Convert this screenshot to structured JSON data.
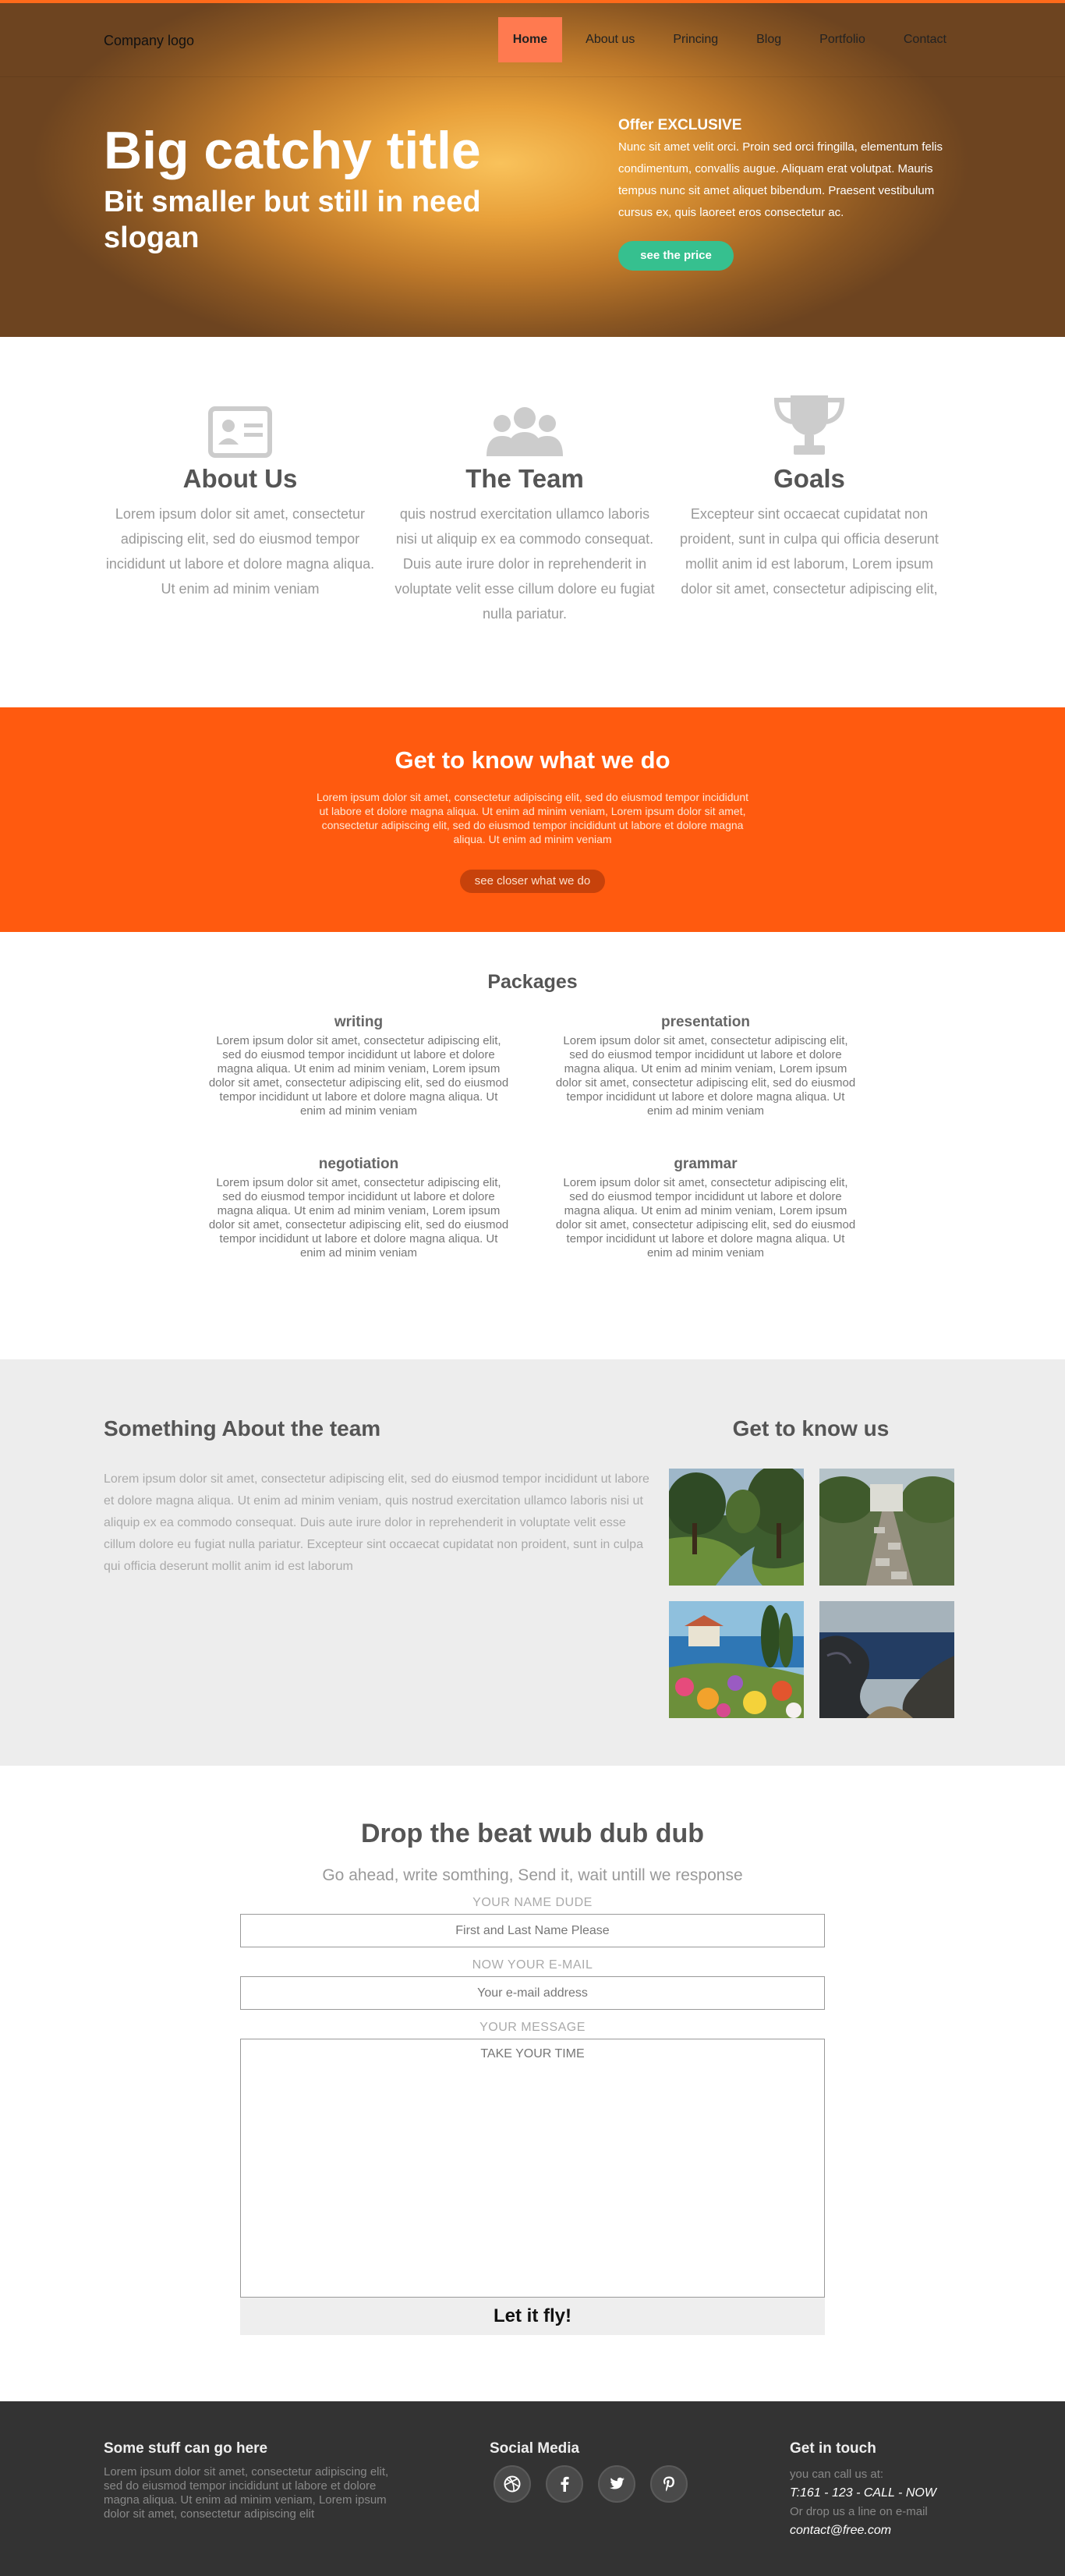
{
  "header": {
    "logo": "Company logo",
    "nav": [
      "Home",
      "About us",
      "Princing",
      "Blog",
      "Portfolio",
      "Contact"
    ]
  },
  "hero": {
    "title": "Big catchy title",
    "slogan": "Bit smaller but still in need slogan",
    "offer_title": "Offer EXCLUSIVE",
    "offer_text": "Nunc sit amet velit orci. Proin sed orci fringilla, elementum felis condimentum, convallis augue. Aliquam erat volutpat. Mauris tempus nunc sit amet aliquet bibendum. Praesent vestibulum cursus ex, quis laoreet eros consectetur ac.",
    "button": "see the price"
  },
  "features": [
    {
      "icon": "id-card-icon",
      "title": "About Us",
      "text": "Lorem ipsum dolor sit amet, consectetur adipiscing elit, sed do eiusmod tempor incididunt ut labore et dolore magna aliqua. Ut enim ad minim veniam"
    },
    {
      "icon": "team-icon",
      "title": "The Team",
      "text": "quis nostrud exercitation ullamco laboris nisi ut aliquip ex ea commodo consequat. Duis aute irure dolor in reprehenderit in voluptate velit esse cillum dolore eu fugiat nulla pariatur."
    },
    {
      "icon": "trophy-icon",
      "title": "Goals",
      "text": "Excepteur sint occaecat cupidatat non proident, sunt in culpa qui officia deserunt mollit anim id est laborum, Lorem ipsum dolor sit amet, consectetur adipiscing elit,"
    }
  ],
  "band": {
    "title": "Get to know what we do",
    "text": "Lorem ipsum dolor sit amet, consectetur adipiscing elit, sed do eiusmod tempor incididunt ut labore et dolore magna aliqua. Ut enim ad minim veniam, Lorem ipsum dolor sit amet, consectetur adipiscing elit, sed do eiusmod tempor incididunt ut labore et dolore magna aliqua. Ut enim ad minim veniam",
    "button": "see closer what we do"
  },
  "packages": {
    "title": "Packages",
    "items": [
      {
        "title": "writing",
        "text": "Lorem ipsum dolor sit amet, consectetur adipiscing elit, sed do eiusmod tempor incididunt ut labore et dolore magna aliqua. Ut enim ad minim veniam, Lorem ipsum dolor sit amet, consectetur adipiscing elit, sed do eiusmod tempor incididunt ut labore et dolore magna aliqua. Ut enim ad minim veniam"
      },
      {
        "title": "presentation",
        "text": "Lorem ipsum dolor sit amet, consectetur adipiscing elit, sed do eiusmod tempor incididunt ut labore et dolore magna aliqua. Ut enim ad minim veniam, Lorem ipsum dolor sit amet, consectetur adipiscing elit, sed do eiusmod tempor incididunt ut labore et dolore magna aliqua. Ut enim ad minim veniam"
      },
      {
        "title": "negotiation",
        "text": "Lorem ipsum dolor sit amet, consectetur adipiscing elit, sed do eiusmod tempor incididunt ut labore et dolore magna aliqua. Ut enim ad minim veniam, Lorem ipsum dolor sit amet, consectetur adipiscing elit, sed do eiusmod tempor incididunt ut labore et dolore magna aliqua. Ut enim ad minim veniam"
      },
      {
        "title": "grammar",
        "text": "Lorem ipsum dolor sit amet, consectetur adipiscing elit, sed do eiusmod tempor incididunt ut labore et dolore magna aliqua. Ut enim ad minim veniam, Lorem ipsum dolor sit amet, consectetur adipiscing elit, sed do eiusmod tempor incididunt ut labore et dolore magna aliqua. Ut enim ad minim veniam"
      }
    ]
  },
  "team": {
    "title": "Something About the team",
    "text": "Lorem ipsum dolor sit amet, consectetur adipiscing elit, sed do eiusmod tempor incididunt ut labore et dolore magna aliqua. Ut enim ad minim veniam, quis nostrud exercitation ullamco laboris nisi ut aliquip ex ea commodo consequat. Duis aute irure dolor in reprehenderit in voluptate velit esse cillum dolore eu fugiat nulla pariatur. Excepteur sint occaecat cupidatat non proident, sunt in culpa qui officia deserunt mollit anim id est laborum",
    "gallery_title": "Get to know us",
    "gallery": [
      "forest-painting",
      "garden-path-photo",
      "coastal-flowers-painting",
      "sea-cliff-painting"
    ]
  },
  "contact": {
    "title": "Drop the beat wub dub dub",
    "subtitle": "Go ahead, write somthing, Send it, wait untill we response",
    "name_label": "YOUR NAME DUDE",
    "name_placeholder": "First and Last Name Please",
    "email_label": "NOW YOUR E-MAIL",
    "email_placeholder": "Your e-mail address",
    "message_label": "YOUR MESSAGE",
    "message_placeholder": "TAKE YOUR TIME",
    "submit": "Let it fly!"
  },
  "footer": {
    "col1_title": "Some stuff can go here",
    "col1_text": "Lorem ipsum dolor sit amet, consectetur adipiscing elit, sed do eiusmod tempor incididunt ut labore et dolore magna aliqua. Ut enim ad minim veniam, Lorem ipsum dolor sit amet, consectetur adipiscing elit",
    "social_title": "Social Media",
    "socials": [
      "dribbble-icon",
      "facebook-icon",
      "twitter-icon",
      "pinterest-icon"
    ],
    "touch_title": "Get in touch",
    "call_label": "you can call us at:",
    "phone": "T:161 - 123 - CALL - NOW",
    "mail_label": "Or drop us a line on e-mail",
    "email": "contact@free.com"
  },
  "colors": {
    "accent_orange": "#ff5a0f",
    "nav_active": "#ff7a50",
    "cta_green": "#36c08f",
    "footer_bg": "#333333",
    "team_bg": "#ededed"
  }
}
